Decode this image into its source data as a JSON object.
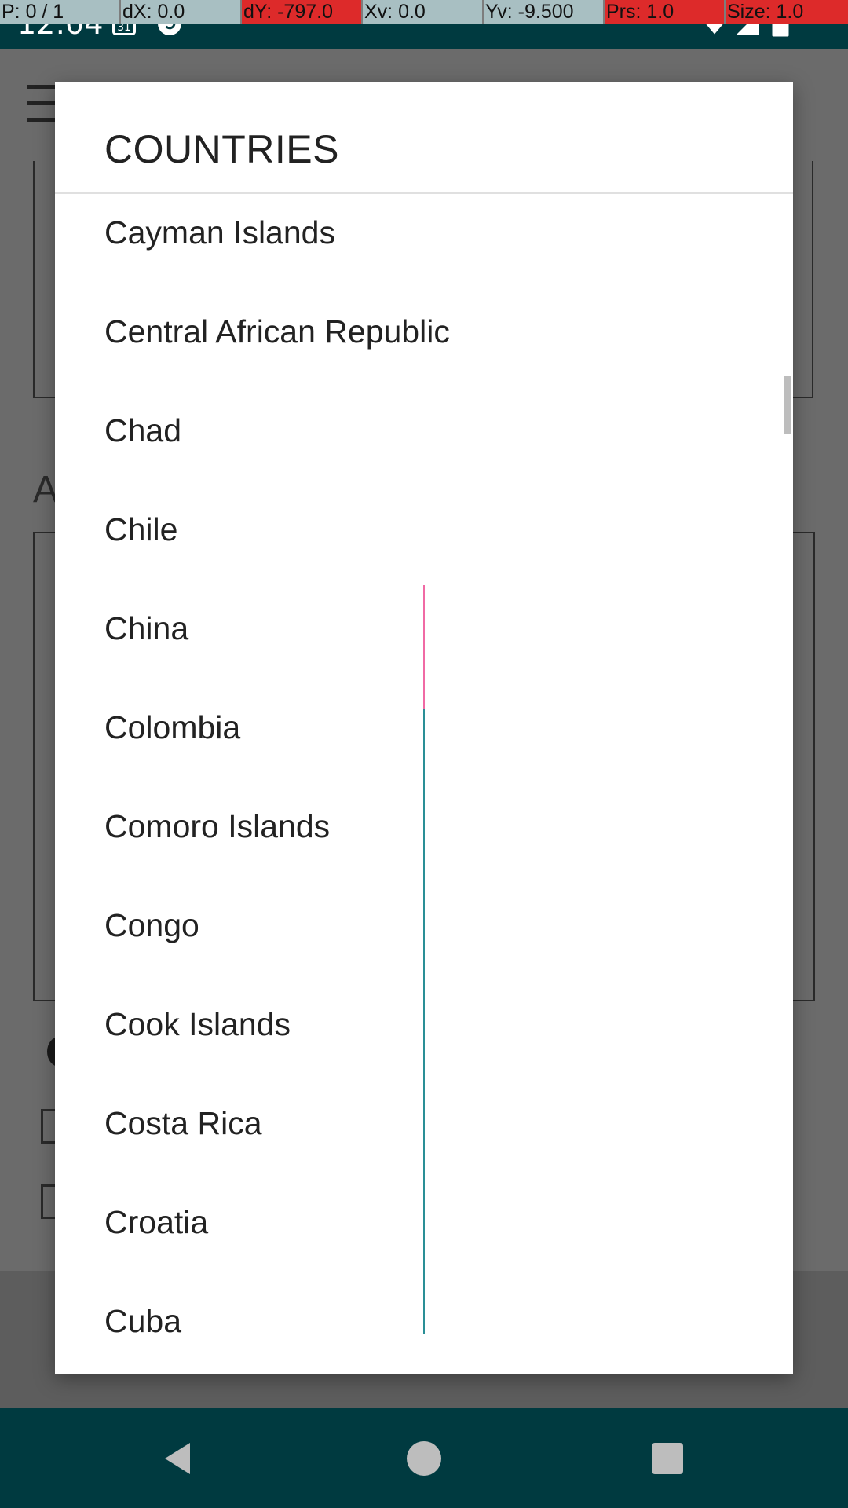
{
  "status_bar": {
    "time": "12:04",
    "icons": [
      "calendar-icon",
      "sync-icon",
      "wifi-icon",
      "signal-icon",
      "battery-icon"
    ],
    "background_color": "#003a40"
  },
  "pointer_overlay": [
    {
      "text": "P: 0 / 1",
      "color": "#a8bfc2"
    },
    {
      "text": "dX: 0.0",
      "color": "#a8bfc2"
    },
    {
      "text": "dY: -797.0",
      "color": "#dd2a2a"
    },
    {
      "text": "Xv: 0.0",
      "color": "#a8bfc2"
    },
    {
      "text": "Yv: -9.500",
      "color": "#a8bfc2"
    },
    {
      "text": "Prs: 1.0",
      "color": "#dd2a2a"
    },
    {
      "text": "Size: 1.0",
      "color": "#dd2a2a"
    }
  ],
  "dialog": {
    "title": "COUNTRIES",
    "countries": [
      "Cayman Islands",
      "Central African Republic",
      "Chad",
      "Chile",
      "China",
      "Colombia",
      "Comoro Islands",
      "Congo",
      "Cook Islands",
      "Costa Rica",
      "Croatia",
      "Cuba"
    ]
  },
  "nav_bar": {
    "buttons": [
      "back-icon",
      "home-icon",
      "recents-icon"
    ],
    "background_color": "#003a40"
  }
}
